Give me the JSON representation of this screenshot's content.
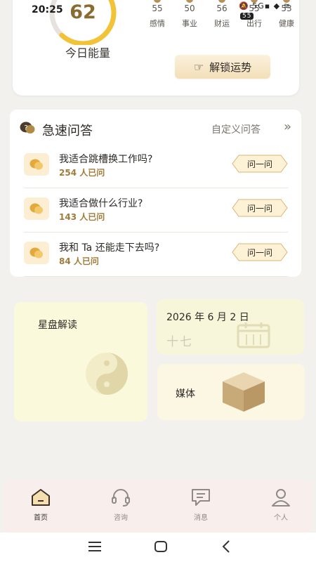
{
  "status_bar": {
    "time": "20:25",
    "icons": "🔕 5G▪ ◆ ≋",
    "battery": "55"
  },
  "energy": {
    "score": "62",
    "label": "今日能量",
    "progress": 0.62,
    "ring_color": "#f2c237"
  },
  "stats": [
    {
      "value": "55",
      "label": "感情"
    },
    {
      "value": "50",
      "label": "事业"
    },
    {
      "value": "56",
      "label": "财运"
    },
    {
      "value": "55",
      "label": "出行"
    },
    {
      "value": "53",
      "label": "健康"
    }
  ],
  "unlock_button": {
    "label": "解锁运势",
    "icon": "pointing-hand-icon"
  },
  "quick_qa": {
    "title": "急速问答",
    "custom_link": "自定义问答",
    "more_icon": "»",
    "ask_label": "问一问",
    "questions": [
      {
        "text": "我适合跳槽换工作吗?",
        "count": "254 人已问"
      },
      {
        "text": "我适合做什么行业?",
        "count": "143 人已问"
      },
      {
        "text": "我和 Ta 还能走下去吗?",
        "count": "84 人已问"
      }
    ]
  },
  "astro_card": {
    "title": "星盘解读",
    "icon": "yin-yang-icon"
  },
  "date_card": {
    "date": "2026 年 6 月 2 日",
    "lunar": "十七",
    "icon": "calendar-icon"
  },
  "media_card": {
    "title": "媒体",
    "icon": "box-icon"
  },
  "tabbar": [
    {
      "label": "首页",
      "icon": "home-icon",
      "active": true
    },
    {
      "label": "咨询",
      "icon": "headset-icon",
      "active": false
    },
    {
      "label": "消息",
      "icon": "message-icon",
      "active": false
    },
    {
      "label": "个人",
      "icon": "person-icon",
      "active": false
    }
  ],
  "system_nav": {
    "menu": "☰",
    "home": "▢",
    "back": "<"
  },
  "colors": {
    "accent_gold": "#a07c3a",
    "ring_yellow": "#f2c237",
    "card_cream": "#fbf9dc"
  }
}
